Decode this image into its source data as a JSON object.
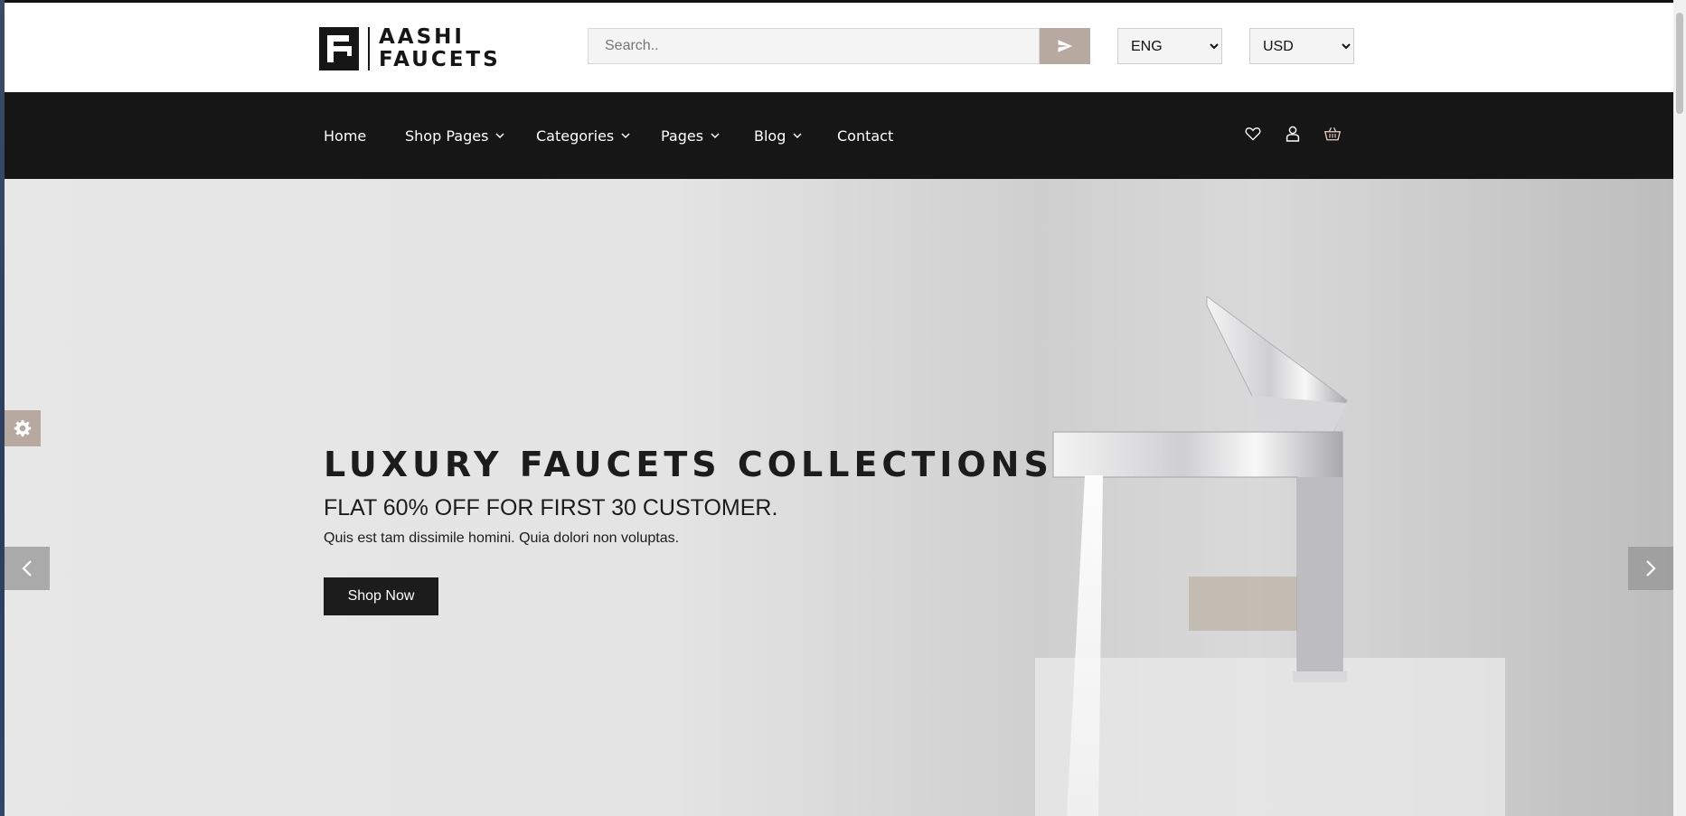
{
  "brand": {
    "line1": "AASHI",
    "line2": "FAUCETS"
  },
  "search": {
    "placeholder": "Search..",
    "value": ""
  },
  "language": {
    "selected": "ENG"
  },
  "currency": {
    "selected": "USD"
  },
  "nav": {
    "items": [
      {
        "label": "Home"
      },
      {
        "label": "Shop Pages"
      },
      {
        "label": "Categories"
      },
      {
        "label": "Pages"
      },
      {
        "label": "Blog"
      },
      {
        "label": "Contact"
      }
    ]
  },
  "hero": {
    "title": "LUXURY FAUCETS COLLECTIONS",
    "subtitle": "FLAT 60% OFF FOR FIRST 30 CUSTOMER.",
    "description": "Quis est tam dissimile homini. Quia dolori non voluptas.",
    "button": "Shop Now"
  },
  "icons": {
    "search_submit": "paper-plane-icon",
    "wishlist": "heart-icon",
    "account": "user-icon",
    "cart": "basket-icon",
    "settings": "gear-icon",
    "prev": "chevron-left-icon",
    "next": "chevron-right-icon"
  },
  "colors": {
    "nav_bg": "#161616",
    "accent": "#b7a9a0",
    "button_bg": "#1c1c1c"
  }
}
